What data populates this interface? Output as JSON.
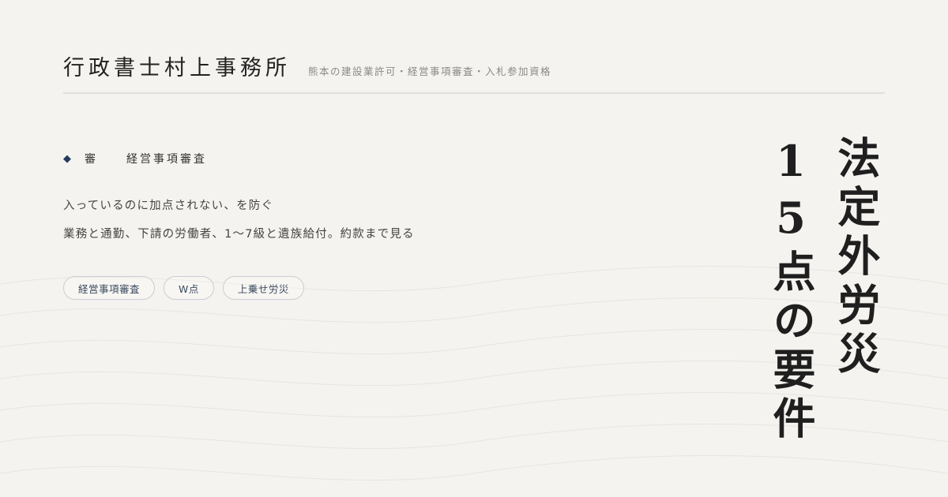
{
  "header": {
    "office_name": "行政書士村上事務所",
    "tagline": "熊本の建設業許可・経営事項審査・入札参加資格"
  },
  "category": {
    "marker": "◆",
    "short_label": "審",
    "label": "経営事項審査"
  },
  "description": {
    "line1": "入っているのに加点されない、を防ぐ",
    "line2": "業務と通勤、下請の労働者、1〜7級と遺族給付。約款まで見る"
  },
  "tags": [
    {
      "label": "経営事項審査"
    },
    {
      "label": "W点"
    },
    {
      "label": "上乗せ労災"
    }
  ],
  "title": {
    "column1": "法定外労災",
    "column2": "15点の要件"
  },
  "colors": {
    "background": "#f4f3ef",
    "accent": "#243a5e",
    "text": "#1f1f1f"
  }
}
